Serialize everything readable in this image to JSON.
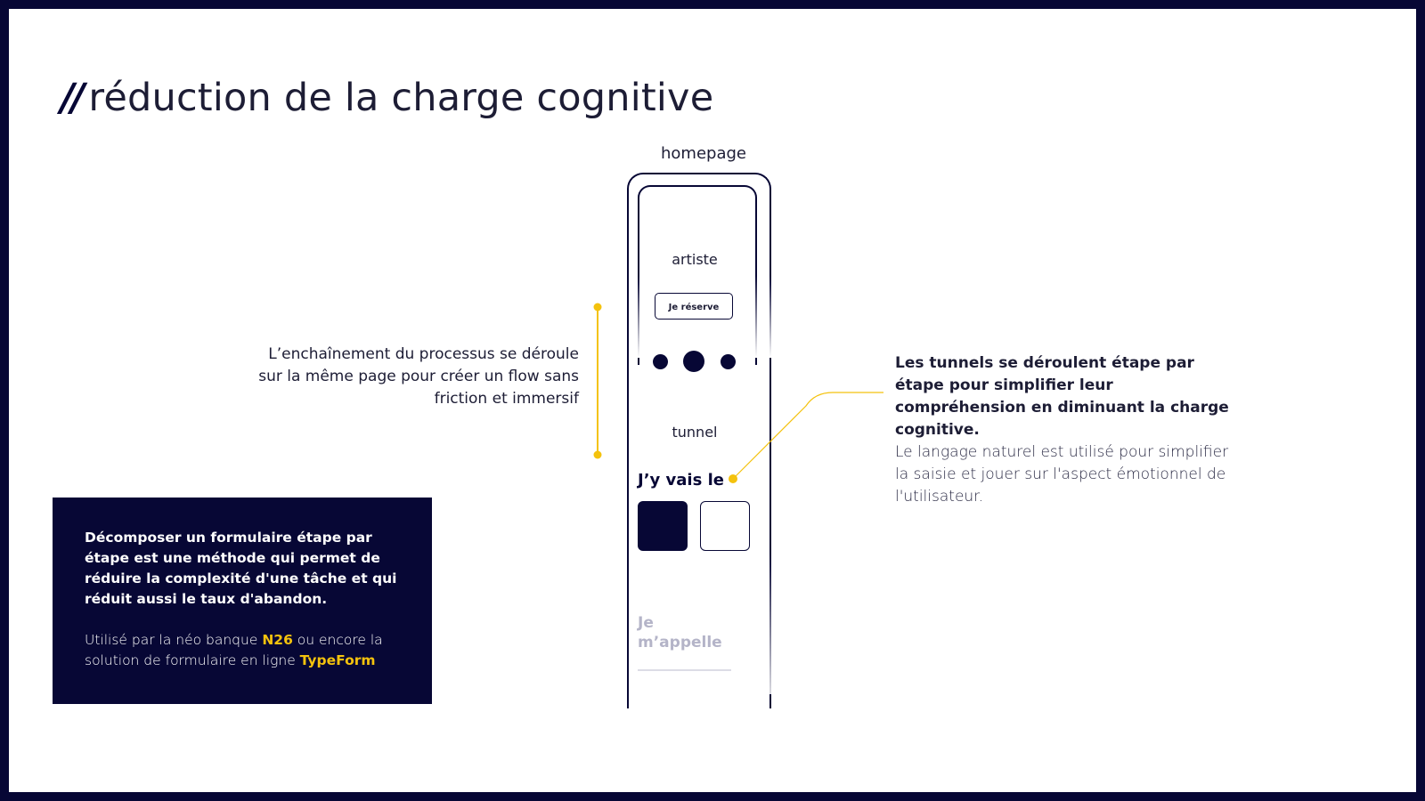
{
  "title": {
    "prefix": "//",
    "text": "réduction de la charge cognitive"
  },
  "mockup": {
    "label": "homepage",
    "artist_text": "artiste",
    "reserve_button": "Je réserve",
    "tunnel_text": "tunnel",
    "question1": "J’y vais le",
    "question2": "Je m’appelle"
  },
  "left_annotation": {
    "text": "L’enchaînement du processus se déroule sur la même page pour créer un flow sans friction et immersif"
  },
  "right_annotation": {
    "bold": "Les tunnels se déroulent étape par étape pour simplifier leur compréhension en diminuant la charge cognitive.",
    "normal": "Le langage naturel est utilisé pour simplifier la saisie et jouer sur l'aspect émotionnel de l'utilisateur."
  },
  "info_box": {
    "paragraph1": "Décomposer un formulaire étape par étape est une méthode qui permet de réduire la complexité d'une tâche et qui réduit aussi le taux d'abandon.",
    "p2_part1": "Utilisé par la néo banque ",
    "p2_highlight1": "N26",
    "p2_part2": " ou encore la solution de formulaire en ligne ",
    "p2_highlight2": "TypeForm"
  },
  "colors": {
    "background_frame": "#070735",
    "accent_yellow": "#f4c20d",
    "text_dark": "#1d1d35",
    "muted": "#b4b4c8"
  }
}
